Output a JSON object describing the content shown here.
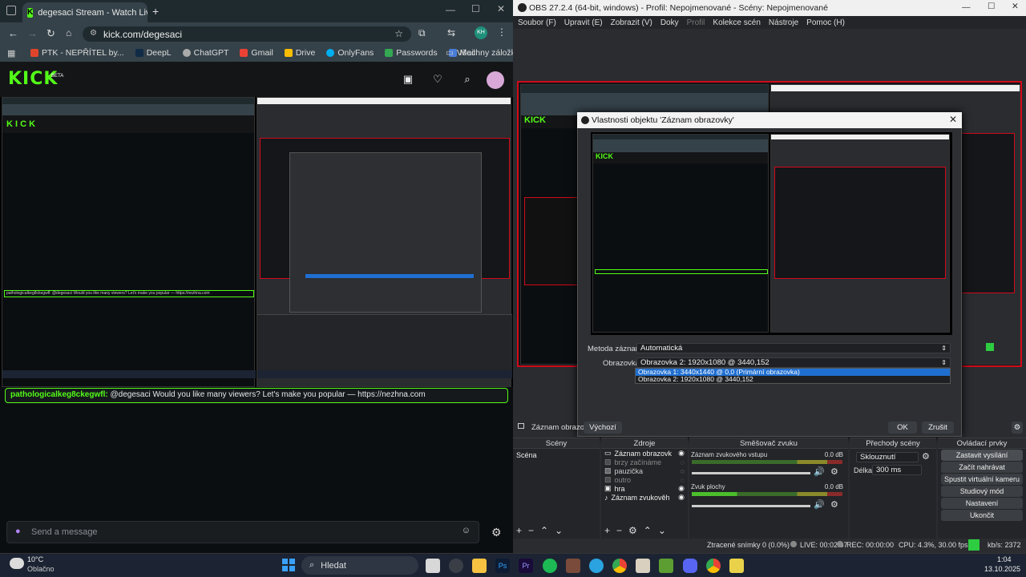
{
  "chrome": {
    "tab_title": "degesaci Stream - Watch Live o",
    "url": "kick.com/degesaci",
    "profile_initials": "KH",
    "bookmarks": [
      "PTK - NEPŘÍTEL by...",
      "DeepL",
      "ChatGPT",
      "Gmail",
      "Drive",
      "OnlyFans",
      "Passwords",
      "Mail"
    ],
    "all_bookmarks": "Všechny záložky"
  },
  "kick": {
    "logo": "KICK",
    "beta": "BETA",
    "chat_user": "pathologicalkeg8ckegwfl:",
    "chat_message": "@degesaci Would you like many viewers? Let's make you popular — https://nezhna.com",
    "send_placeholder": "Send a message"
  },
  "obs": {
    "window_title": "OBS 27.2.4 (64-bit, windows) - Profil: Nepojmenované - Scény: Nepojmenované",
    "menu": [
      "Soubor (F)",
      "Upravit (E)",
      "Zobrazit (V)",
      "Doky",
      "Profil",
      "Kolekce scén",
      "Nástroje",
      "Pomoc (H)"
    ],
    "dialog": {
      "title": "Vlastnosti objektu 'Záznam obrazovky'",
      "method_label": "Metoda záznamu",
      "method_value": "Automatická",
      "screen_label": "Obrazovka",
      "screen_value": "Obrazovka 2: 1920x1080 @ 3440,152",
      "options": [
        "Obrazovka 1: 3440x1440 @ 0,0 (Primární obrazovka)",
        "Obrazovka 2: 1920x1080 @ 3440,152"
      ],
      "source_name": "Záznam obrazovk",
      "defaults": "Výchozí",
      "ok": "OK",
      "cancel": "Zrušit"
    },
    "docks": {
      "scenes": "Scény",
      "scene_items": [
        "Scéna"
      ],
      "sources": "Zdroje",
      "source_items": [
        "Záznam obrazovk",
        "brzy začínáme",
        "pauzička",
        "outro",
        "hra",
        "Záznam zvukověh"
      ],
      "mixer": "Směšovač zvuku",
      "mixer_tracks": [
        {
          "name": "Záznam zvukového vstupu",
          "db": "0.0 dB"
        },
        {
          "name": "Zvuk plochy",
          "db": "0.0 dB"
        }
      ],
      "transitions": "Přechody scény",
      "transition_value": "Sklouznutí",
      "duration_label": "Délka",
      "duration_value": "300 ms",
      "controls": "Ovládací prvky",
      "control_buttons": [
        "Zastavit vysílání",
        "Začít nahrávat",
        "Spustit virtuální kameru",
        "Studiový mód",
        "Nastavení",
        "Ukončit"
      ]
    },
    "status": {
      "dropped": "Ztracené snímky 0 (0.0%)",
      "live": "LIVE: 00:02:07",
      "rec": "REC: 00:00:00",
      "cpu": "CPU: 4.3%, 30.00 fps",
      "kbs": "kb/s: 2372"
    }
  },
  "taskbar": {
    "temp": "10°C",
    "weather": "Oblačno",
    "search": "Hledat",
    "time": "1:04",
    "date": "13.10.2025"
  },
  "colors": {
    "kick_green": "#53fc18",
    "obs_red": "#d10a1a",
    "select_blue": "#1f6fd1"
  }
}
